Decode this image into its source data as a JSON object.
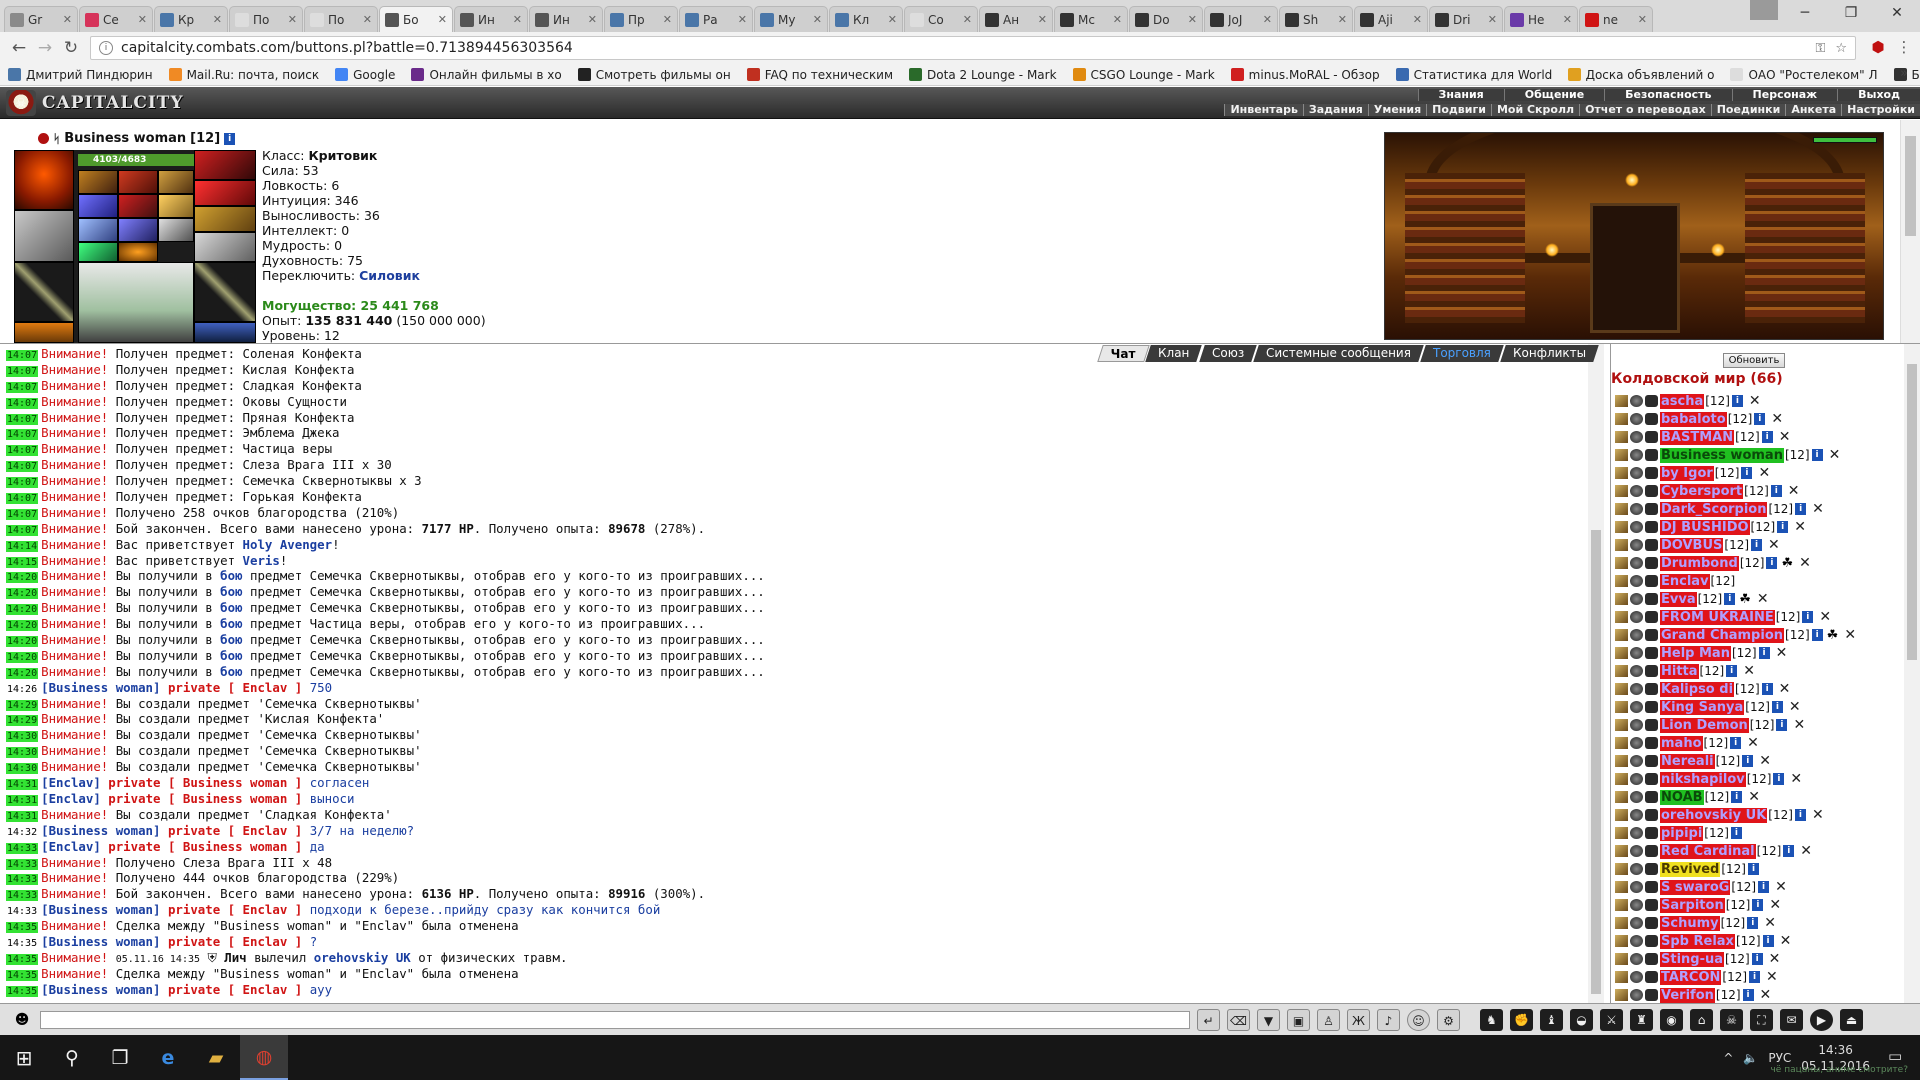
{
  "browser": {
    "tabs": [
      {
        "title": "Gr",
        "color": "#8a8a8a"
      },
      {
        "title": "Ce",
        "color": "#d6335a"
      },
      {
        "title": "Кр",
        "color": "#4a76a8"
      },
      {
        "title": "По",
        "color": "#dddddd"
      },
      {
        "title": "По",
        "color": "#dddddd"
      },
      {
        "title": "Бо",
        "color": "#555555",
        "active": true
      },
      {
        "title": "Ин",
        "color": "#555555"
      },
      {
        "title": "Ин",
        "color": "#555555"
      },
      {
        "title": "Пр",
        "color": "#4a76a8"
      },
      {
        "title": "Ра",
        "color": "#4a76a8"
      },
      {
        "title": "Му",
        "color": "#4a76a8"
      },
      {
        "title": "Кл",
        "color": "#4a76a8"
      },
      {
        "title": "Со",
        "color": "#dddddd"
      },
      {
        "title": "Ан",
        "color": "#333333"
      },
      {
        "title": "Мс",
        "color": "#333333"
      },
      {
        "title": "Do",
        "color": "#333333"
      },
      {
        "title": "JoJ",
        "color": "#333333"
      },
      {
        "title": "Sh",
        "color": "#333333"
      },
      {
        "title": "Aji",
        "color": "#333333"
      },
      {
        "title": "Dri",
        "color": "#333333"
      },
      {
        "title": "He",
        "color": "#6a3aa8"
      },
      {
        "title": "ne",
        "color": "#d01414"
      }
    ],
    "url": "capitalcity.combats.com/buttons.pl?battle=0.713894456303564",
    "bookmarks": [
      {
        "label": "Дмитрий Пиндюрин",
        "color": "#4a76a8"
      },
      {
        "label": "Mail.Ru: почта, поиск",
        "color": "#f08a24"
      },
      {
        "label": "Google",
        "color": "#4285f4"
      },
      {
        "label": "Онлайн фильмы в хо",
        "color": "#6a2a8a"
      },
      {
        "label": "Смотреть фильмы он",
        "color": "#222222"
      },
      {
        "label": "FAQ по техническим",
        "color": "#c03020"
      },
      {
        "label": "Dota 2 Lounge - Mark",
        "color": "#2a6a2a"
      },
      {
        "label": "CSGO Lounge - Mark",
        "color": "#e08a10"
      },
      {
        "label": "minus.MoRAL - Обзор",
        "color": "#d02020"
      },
      {
        "label": "Статистика для World",
        "color": "#3a6ab0"
      },
      {
        "label": "Доска объявлений о",
        "color": "#e0a020"
      },
      {
        "label": "ОАО \"Ростелеком\" Л",
        "color": "#dddddd"
      },
      {
        "label": "Бойцовский клуб - о",
        "color": "#333333"
      }
    ]
  },
  "game": {
    "logo": "CAPITALCITY",
    "top_menu": [
      "Знания",
      "Общение",
      "Безопасность",
      "Персонаж",
      "Выход"
    ],
    "sub_menu": [
      "Инвентарь",
      "Задания",
      "Умения",
      "Подвиги",
      "Мой Скролл",
      "Отчет о переводах",
      "Поединки",
      "Анкета",
      "Настройки"
    ]
  },
  "character": {
    "name": "Business woman",
    "level": "[12]",
    "hp": "4103/4683",
    "stats": [
      {
        "label": "Класс: ",
        "value": "Критовик",
        "style": "bold"
      },
      {
        "label": "Сила: ",
        "value": "53",
        "style": ""
      },
      {
        "label": "Ловкость: ",
        "value": "6",
        "style": ""
      },
      {
        "label": "Интуиция: ",
        "value": "346",
        "style": ""
      },
      {
        "label": "Выносливость: ",
        "value": "36",
        "style": ""
      },
      {
        "label": "Интеллект: ",
        "value": "0",
        "style": ""
      },
      {
        "label": "Мудрость: ",
        "value": "0",
        "style": ""
      },
      {
        "label": "Духовность: ",
        "value": "75",
        "style": ""
      },
      {
        "label": "Переключить: ",
        "value": "Силовик",
        "style": "blue"
      }
    ],
    "power_label": "Могущество: ",
    "power_value": "25 441 768",
    "exp_label": "Опыт: ",
    "exp_value": "135 831 440",
    "exp_next": " (150 000 000)",
    "level_label": "Уровень: ",
    "level_value": "12"
  },
  "chat": {
    "tabs": [
      {
        "label": "Чат",
        "active": true
      },
      {
        "label": "Клан"
      },
      {
        "label": "Союз"
      },
      {
        "label": "Системные сообщения"
      },
      {
        "label": "Торговля",
        "blue": true
      },
      {
        "label": "Конфликты"
      }
    ],
    "messages": [
      {
        "time": "14:07",
        "type": "warn",
        "text": "Получен предмет: Соленая Конфекта"
      },
      {
        "time": "14:07",
        "type": "warn",
        "text": "Получен предмет: Кислая Конфекта"
      },
      {
        "time": "14:07",
        "type": "warn",
        "text": "Получен предмет: Сладкая Конфекта"
      },
      {
        "time": "14:07",
        "type": "warn",
        "text": "Получен предмет: Оковы Сущности"
      },
      {
        "time": "14:07",
        "type": "warn",
        "text": "Получен предмет: Пряная Конфекта"
      },
      {
        "time": "14:07",
        "type": "warn",
        "text": "Получен предмет: Эмблема Джека"
      },
      {
        "time": "14:07",
        "type": "warn",
        "text": "Получен предмет: Частица веры"
      },
      {
        "time": "14:07",
        "type": "warn",
        "text": "Получен предмет: Слеза Врага III x 30"
      },
      {
        "time": "14:07",
        "type": "warn",
        "text": "Получен предмет: Семечка Сквернотыквы x 3"
      },
      {
        "time": "14:07",
        "type": "warn",
        "text": "Получен предмет: Горькая Конфекта"
      },
      {
        "time": "14:07",
        "type": "warn",
        "text": "Получено 258 очков благородства (210%)"
      },
      {
        "time": "14:07",
        "type": "warn",
        "text": "Бой закончен. Всего вами нанесено урона: ",
        "b1": "7177 HP",
        "t2": ". Получено опыта: ",
        "b2": "89678",
        "t3": " (278%)."
      },
      {
        "time": "14:14",
        "type": "warn",
        "text": "Вас приветствует ",
        "nick": "Holy Avenger",
        "t2": "!"
      },
      {
        "time": "14:15",
        "type": "warn",
        "text": "Вас приветствует ",
        "nick": "Veris",
        "t2": "!"
      },
      {
        "time": "14:20",
        "type": "warn",
        "text": "Вы получили в ",
        "nick": "бою",
        "t2": " предмет Семечка Сквернотыквы, отобрав его у кого-то из проигравших..."
      },
      {
        "time": "14:20",
        "type": "warn",
        "text": "Вы получили в ",
        "nick": "бою",
        "t2": " предмет Семечка Сквернотыквы, отобрав его у кого-то из проигравших..."
      },
      {
        "time": "14:20",
        "type": "warn",
        "text": "Вы получили в ",
        "nick": "бою",
        "t2": " предмет Семечка Сквернотыквы, отобрав его у кого-то из проигравших..."
      },
      {
        "time": "14:20",
        "type": "warn",
        "text": "Вы получили в ",
        "nick": "бою",
        "t2": " предмет Частица веры, отобрав его у кого-то из проигравших..."
      },
      {
        "time": "14:20",
        "type": "warn",
        "text": "Вы получили в ",
        "nick": "бою",
        "t2": " предмет Семечка Сквернотыквы, отобрав его у кого-то из проигравших..."
      },
      {
        "time": "14:20",
        "type": "warn",
        "text": "Вы получили в ",
        "nick": "бою",
        "t2": " предмет Семечка Сквернотыквы, отобрав его у кого-то из проигравших..."
      },
      {
        "time": "14:20",
        "type": "warn",
        "text": "Вы получили в ",
        "nick": "бою",
        "t2": " предмет Семечка Сквернотыквы, отобрав его у кого-то из проигравших..."
      },
      {
        "time": "14:26",
        "plain": true,
        "type": "priv",
        "from": "Business woman",
        "to": "Enclav",
        "text": "750"
      },
      {
        "time": "14:29",
        "type": "warn",
        "text": "Вы создали предмет 'Семечка Сквернотыквы'"
      },
      {
        "time": "14:29",
        "type": "warn",
        "text": "Вы создали предмет 'Кислая Конфекта'"
      },
      {
        "time": "14:30",
        "type": "warn",
        "text": "Вы создали предмет 'Семечка Сквернотыквы'"
      },
      {
        "time": "14:30",
        "type": "warn",
        "text": "Вы создали предмет 'Семечка Сквернотыквы'"
      },
      {
        "time": "14:30",
        "type": "warn",
        "text": "Вы создали предмет 'Семечка Сквернотыквы'"
      },
      {
        "time": "14:31",
        "type": "priv",
        "from": "Enclav",
        "to": "Business woman",
        "text": "согласен"
      },
      {
        "time": "14:31",
        "type": "priv",
        "from": "Enclav",
        "to": "Business woman",
        "text": "выноси"
      },
      {
        "time": "14:31",
        "type": "warn",
        "text": "Вы создали предмет 'Сладкая Конфекта'"
      },
      {
        "time": "14:32",
        "plain": true,
        "type": "priv",
        "from": "Business woman",
        "to": "Enclav",
        "text": "3/7 на неделю?"
      },
      {
        "time": "14:33",
        "type": "priv",
        "from": "Enclav",
        "to": "Business woman",
        "text": "да"
      },
      {
        "time": "14:33",
        "type": "warn",
        "text": "Получено Слеза Врага III x 48"
      },
      {
        "time": "14:33",
        "type": "warn",
        "text": "Получено 444 очков благородства (229%)"
      },
      {
        "time": "14:33",
        "type": "warn",
        "text": "Бой закончен. Всего вами нанесено урона: ",
        "b1": "6136 HP",
        "t2": ". Получено опыта: ",
        "b2": "89916",
        "t3": " (300%)."
      },
      {
        "time": "14:33",
        "plain": true,
        "type": "priv",
        "from": "Business woman",
        "to": "Enclav",
        "text": "подходи к березе..прийду сразу как кончится бой"
      },
      {
        "time": "14:35",
        "type": "warn",
        "text": "Сделка между \"Business woman\" и \"Enclav\" была отменена"
      },
      {
        "time": "14:35",
        "plain": true,
        "type": "priv",
        "from": "Business woman",
        "to": "Enclav",
        "text": "?"
      },
      {
        "time": "14:35",
        "type": "heal",
        "stamp": "05.11.16 14:35",
        "actor": "Лич",
        "verb": " вылечил ",
        "target": "orehovskiy UK",
        "rest": " от физических травм."
      },
      {
        "time": "14:35",
        "type": "warn",
        "text": "Сделка между \"Business woman\" и \"Enclav\" была отменена"
      },
      {
        "time": "14:35",
        "type": "priv",
        "from": "Business woman",
        "to": "Enclav",
        "text": "ауу"
      }
    ],
    "warn_label": "Внимание!",
    "private_label": "private",
    "input_placeholder": ""
  },
  "online": {
    "refresh_label": "Обновить",
    "title": "Колдовской мир (66)",
    "users": [
      {
        "name": "ascha",
        "level": "[12]"
      },
      {
        "name": "babaloto",
        "level": "[12]"
      },
      {
        "name": "BASTMAN",
        "level": "[12]"
      },
      {
        "name": "Business woman",
        "level": "[12]",
        "style": "me"
      },
      {
        "name": "by Igor",
        "level": "[12]"
      },
      {
        "name": "Cybersport",
        "level": "[12]"
      },
      {
        "name": "Dark_Scorpion",
        "level": "[12]"
      },
      {
        "name": "DJ BUSHIDO",
        "level": "[12]"
      },
      {
        "name": "DOVBUS",
        "level": "[12]"
      },
      {
        "name": "Drumbond",
        "level": "[12]",
        "extra": "☘"
      },
      {
        "name": "Enclav",
        "level": "[12]",
        "noinfo": true,
        "nox": true
      },
      {
        "name": "Evva",
        "level": "[12]",
        "extra": "☘"
      },
      {
        "name": "FROM UKRAINE",
        "level": "[12]"
      },
      {
        "name": "Grand Champion",
        "level": "[12]",
        "extra": "☘"
      },
      {
        "name": "Help Man",
        "level": "[12]"
      },
      {
        "name": "Hitta",
        "level": "[12]"
      },
      {
        "name": "Kalipso di",
        "level": "[12]"
      },
      {
        "name": "King Sanya",
        "level": "[12]"
      },
      {
        "name": "Lion Demon",
        "level": "[12]"
      },
      {
        "name": "maho",
        "level": "[12]"
      },
      {
        "name": "Nereali",
        "level": "[12]"
      },
      {
        "name": "nikshapilov",
        "level": "[12]"
      },
      {
        "name": "NOAB",
        "level": "[12]",
        "style": "green"
      },
      {
        "name": "orehovskiy UK",
        "level": "[12]"
      },
      {
        "name": "pipipi",
        "level": "[12]",
        "nox": true
      },
      {
        "name": "Red Cardinal",
        "level": "[12]"
      },
      {
        "name": "Revived",
        "level": "[12]",
        "style": "yellow",
        "nox": true
      },
      {
        "name": "S swaroG",
        "level": "[12]"
      },
      {
        "name": "Sarpiton",
        "level": "[12]"
      },
      {
        "name": "Schumy",
        "level": "[12]"
      },
      {
        "name": "Spb Relax",
        "level": "[12]"
      },
      {
        "name": "Sting-ua",
        "level": "[12]"
      },
      {
        "name": "TARCON",
        "level": "[12]"
      },
      {
        "name": "Verifon",
        "level": "[12]"
      }
    ]
  },
  "taskbar": {
    "lang": "РУС",
    "time": "14:36",
    "date": "05.11.2016",
    "hint": "чё пацаны, аниме смотрите?"
  }
}
